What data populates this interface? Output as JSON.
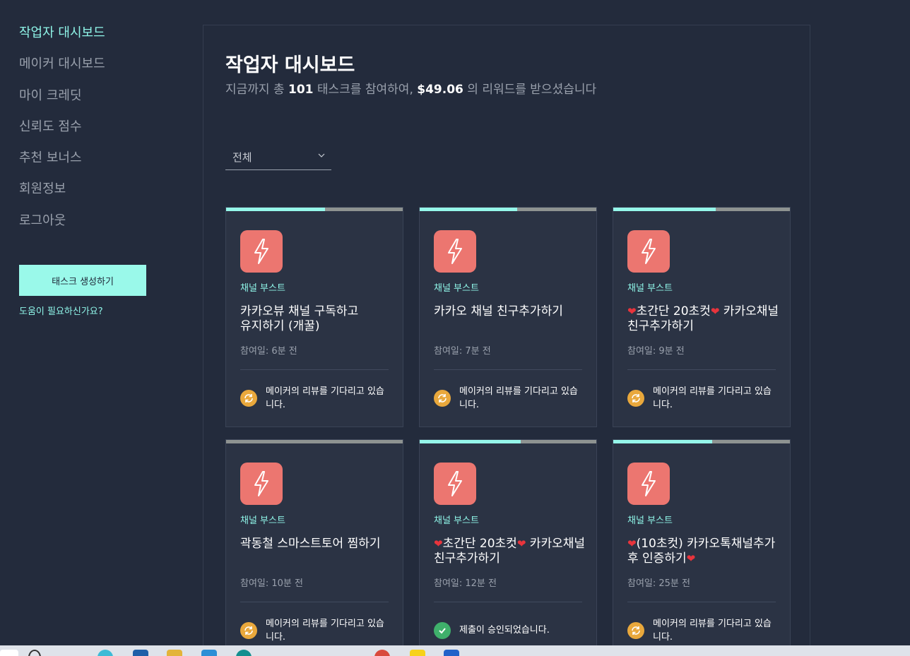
{
  "sidebar": {
    "items": [
      {
        "label": "작업자 대시보드",
        "active": true
      },
      {
        "label": "메이커 대시보드",
        "active": false
      },
      {
        "label": "마이 크레딧",
        "active": false
      },
      {
        "label": "신뢰도 점수",
        "active": false
      },
      {
        "label": "추천 보너스",
        "active": false
      },
      {
        "label": "회원정보",
        "active": false
      },
      {
        "label": "로그아웃",
        "active": false
      }
    ],
    "create_button": "태스크 생성하기",
    "help_link": "도움이 필요하신가요?"
  },
  "main": {
    "title": "작업자 대시보드",
    "summary": {
      "prefix": "지금까지 총",
      "task_count": "101",
      "middle": "태스크를 참여하여,",
      "reward": "$49.06",
      "suffix": "의 리워드를 받으셨습니다"
    },
    "filter": {
      "value": "전체"
    }
  },
  "cards": [
    {
      "category": "채널 부스트",
      "title": "카카오뷰 채널 구독하고 유지하기 (개꿀)",
      "date": "참여일: 6분 전",
      "status": "메이커의 리뷰를 기다리고 있습니다.",
      "status_type": "pending",
      "progress": 0.56
    },
    {
      "category": "채널 부스트",
      "title": "카카오 채널 친구추가하기",
      "date": "참여일: 7분 전",
      "status": "메이커의 리뷰를 기다리고 있습니다.",
      "status_type": "pending",
      "progress": 0.55
    },
    {
      "category": "채널 부스트",
      "title": "❤️초간단 20초컷❤️ 카카오채널 친구추가하기",
      "date": "참여일: 9분 전",
      "status": "메이커의 리뷰를 기다리고 있습니다.",
      "status_type": "pending",
      "progress": 0.58
    },
    {
      "category": "채널 부스트",
      "title": "곽동철 스마스트토어 찜하기",
      "date": "참여일: 10분 전",
      "status": "메이커의 리뷰를 기다리고 있습니다.",
      "status_type": "pending",
      "progress": 0.0
    },
    {
      "category": "채널 부스트",
      "title": "❤️초간단 20초컷❤️ 카카오채널 친구추가하기",
      "date": "참여일: 12분 전",
      "status": "제출이 승인되었습니다.",
      "status_type": "approved",
      "progress": 0.57
    },
    {
      "category": "채널 부스트",
      "title": "❤️(10초컷) 카카오톡채널추가 후 인증하기❤️",
      "date": "참여일: 25분 전",
      "status": "메이커의 리뷰를 기다리고 있습니다.",
      "status_type": "pending",
      "progress": 0.56
    }
  ],
  "colors": {
    "accent": "#8ff5e8",
    "icon_bg": "#ec7670",
    "pending": "#e9a83c",
    "approved": "#3fb06b",
    "background": "#232b3c",
    "card": "#2b3344"
  },
  "icons": {
    "task": "lightning-icon",
    "pending": "refresh-icon",
    "approved": "check-icon",
    "filter": "chevron-down-icon"
  }
}
